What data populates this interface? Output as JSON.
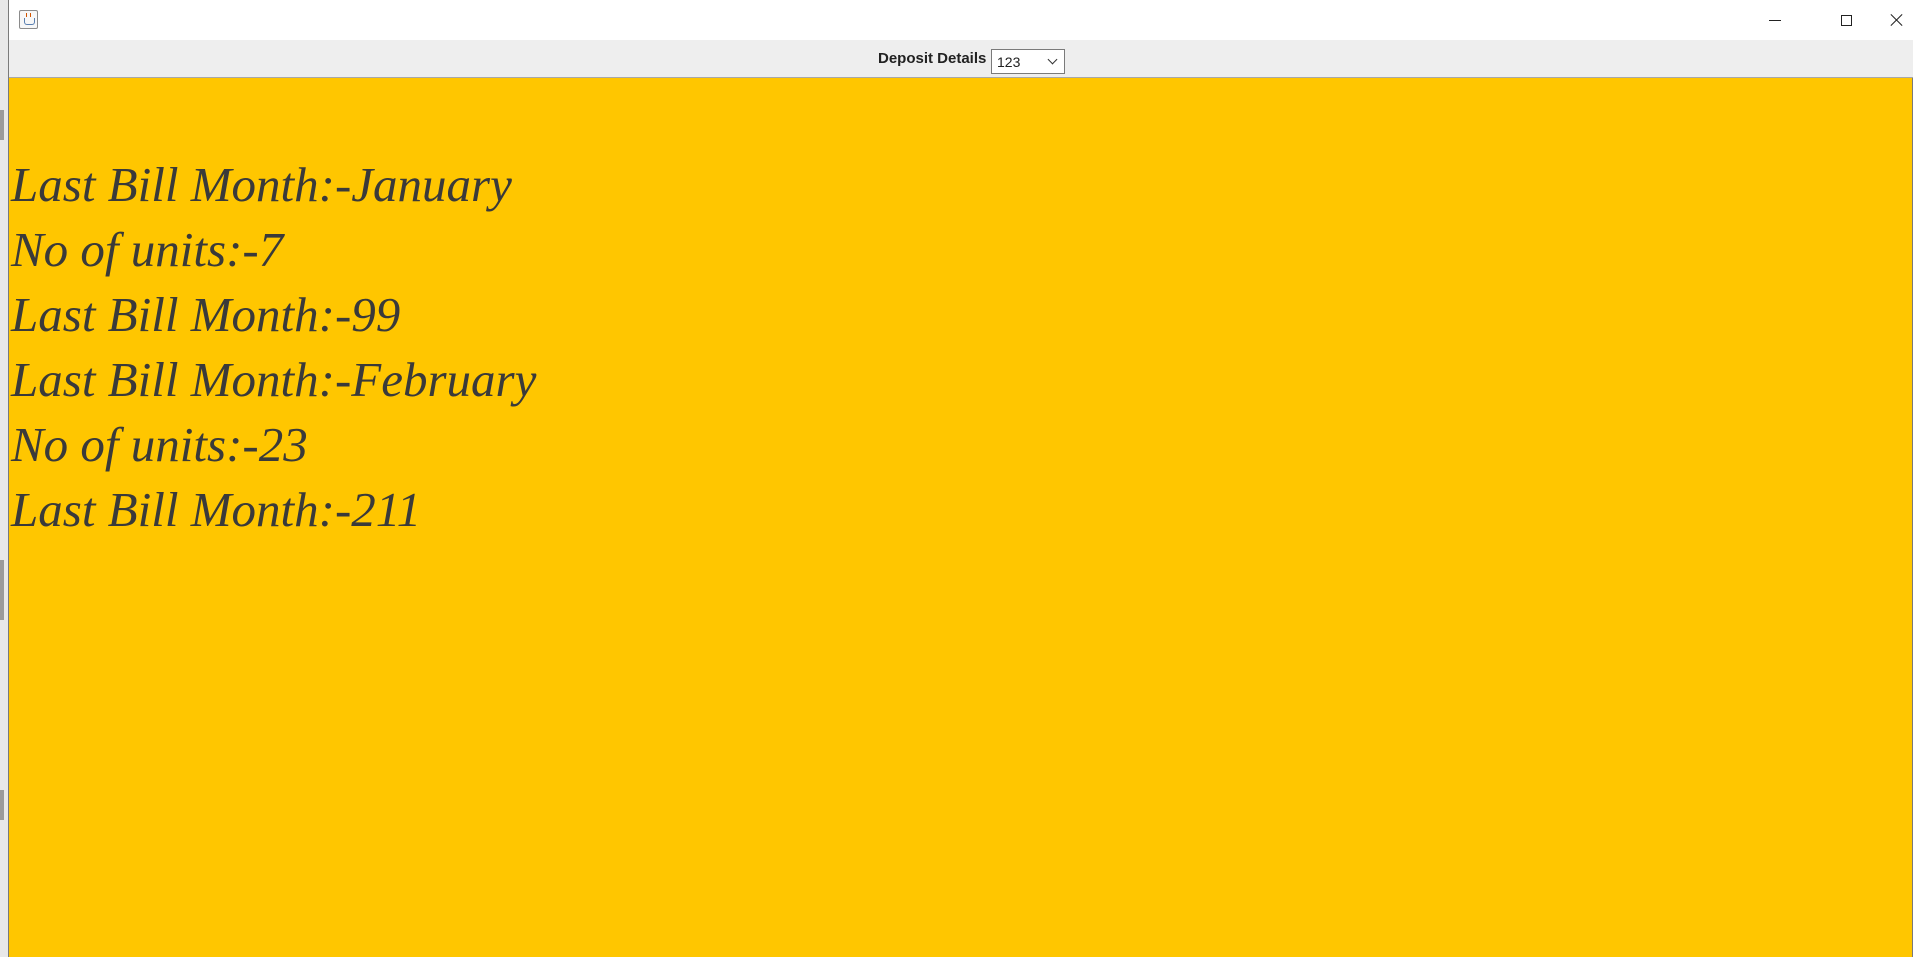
{
  "window": {
    "title": "",
    "icon": "java-app-icon",
    "controls": [
      "minimize-icon",
      "maximize-icon",
      "close-icon"
    ]
  },
  "toolbar": {
    "label": "Deposit Details",
    "select": {
      "value": "123"
    }
  },
  "content": {
    "background_color": "#ffc600",
    "text_color": "#3a3a3a",
    "lines": [
      "Last Bill Month:-January",
      "No of units:-7",
      "Last Bill Month:-99",
      "Last Bill Month:-February",
      "No of units:-23",
      "Last Bill Month:-211"
    ]
  }
}
